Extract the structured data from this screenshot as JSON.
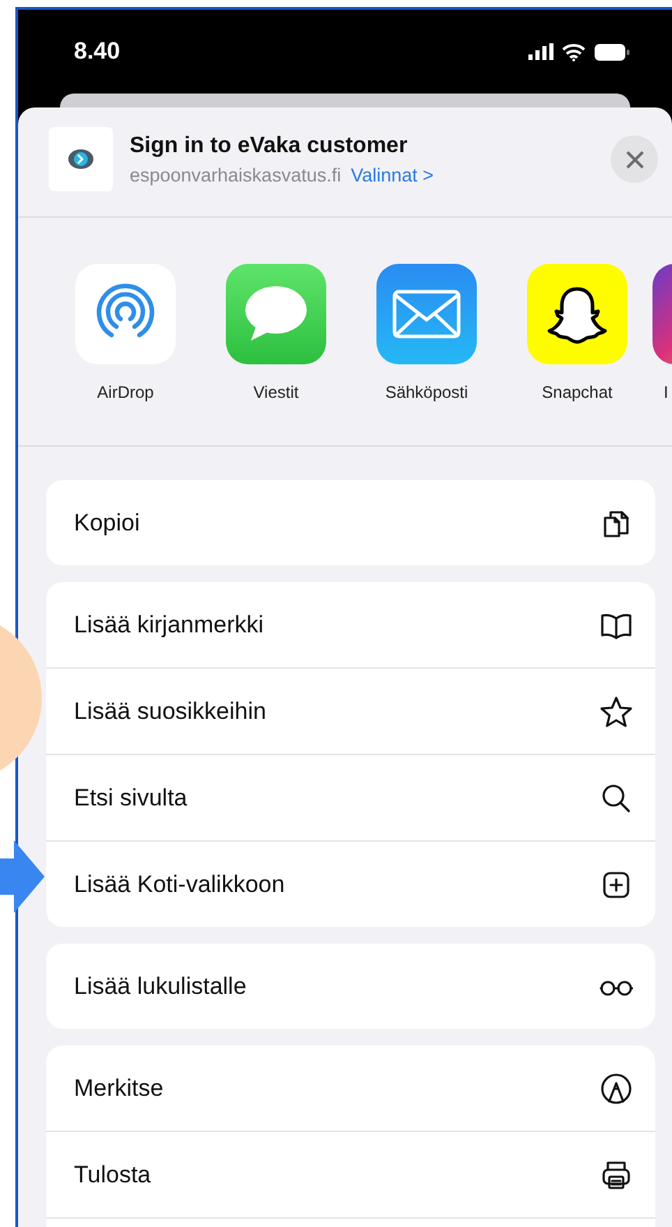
{
  "status_bar": {
    "time": "8.40"
  },
  "share_header": {
    "title": "Sign in to eVaka customer",
    "domain": "espoonvarhaiskasvatus.fi",
    "options_link": "Valinnat >"
  },
  "apps": [
    {
      "label": "AirDrop"
    },
    {
      "label": "Viestit"
    },
    {
      "label": "Sähköposti"
    },
    {
      "label": "Snapchat"
    },
    {
      "label": "I"
    }
  ],
  "action_groups": [
    {
      "items": [
        {
          "label": "Kopioi"
        }
      ]
    },
    {
      "items": [
        {
          "label": "Lisää kirjanmerkki"
        },
        {
          "label": "Lisää suosikkeihin"
        },
        {
          "label": "Etsi sivulta"
        },
        {
          "label": "Lisää Koti-valikkoon"
        }
      ]
    },
    {
      "items": [
        {
          "label": "Lisää lukulistalle"
        }
      ]
    },
    {
      "items": [
        {
          "label": "Merkitse"
        },
        {
          "label": "Tulosta"
        }
      ]
    }
  ]
}
